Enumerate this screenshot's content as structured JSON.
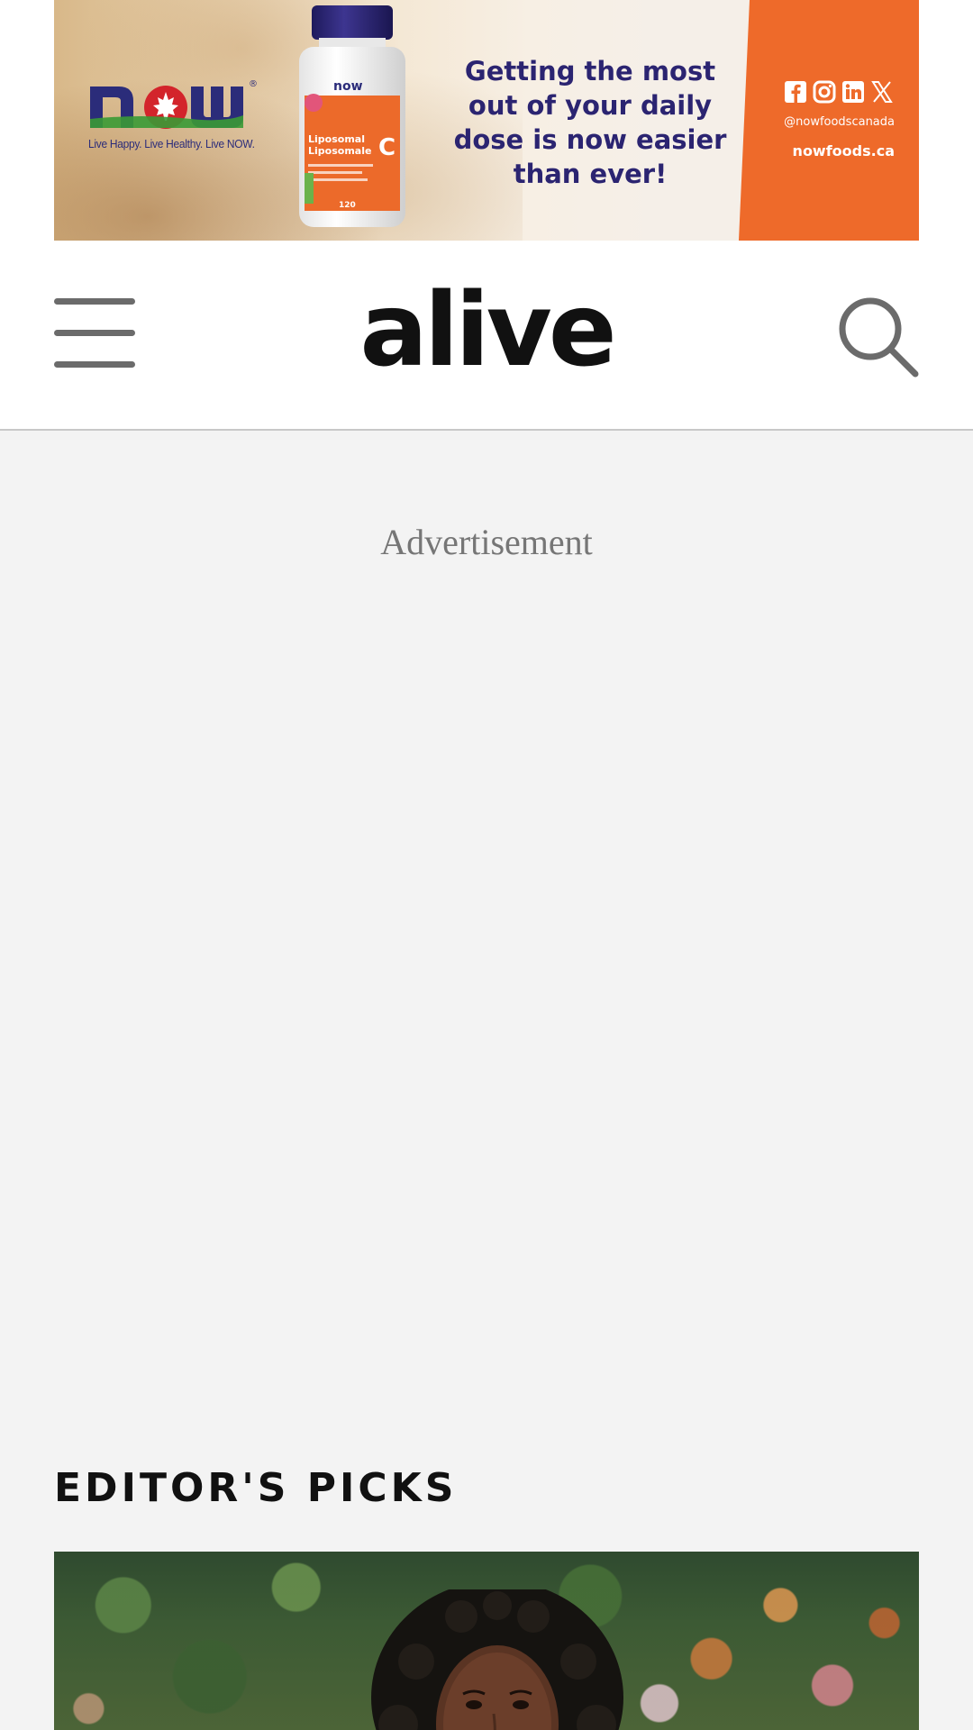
{
  "top_ad": {
    "brand_tagline": "Live Happy. Live Healthy. Live NOW.",
    "product_line1": "Liposomal",
    "product_line2": "Liposomale",
    "product_letter": "C",
    "product_count": "120",
    "headline_line1": "Getting the most",
    "headline_line2": "out of your daily",
    "headline_line3": "dose is now easier",
    "headline_line4": "than ever!",
    "social_handle": "@nowfoodscanada",
    "website": "nowfoods.ca",
    "colors": {
      "orange": "#ee6a2a",
      "navy": "#2b2471",
      "green": "#3a9a35",
      "red": "#d3242b"
    },
    "social_icons": [
      "facebook-icon",
      "instagram-icon",
      "linkedin-icon",
      "x-icon"
    ]
  },
  "header": {
    "logo": "alive",
    "menu_icon": "hamburger-menu-icon",
    "search_icon": "search-icon"
  },
  "ad_slot": {
    "label": "Advertisement"
  },
  "editors_picks": {
    "heading": "EDITOR'S PICKS"
  }
}
